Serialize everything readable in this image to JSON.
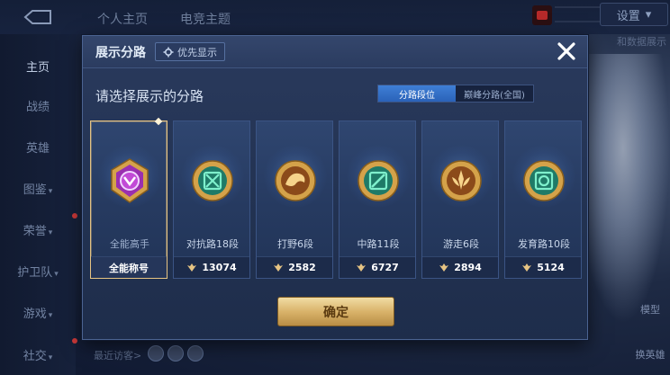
{
  "topbar": {
    "tabs": [
      "个人主页",
      "电竞主题"
    ],
    "settings_label": "设置",
    "right_hint": "和数据展示"
  },
  "sidebar": {
    "items": [
      {
        "label": "主页",
        "active": true
      },
      {
        "label": "战绩"
      },
      {
        "label": "英雄"
      },
      {
        "label": "图鉴",
        "caret": "▾"
      },
      {
        "label": "荣誉",
        "caret": "▾"
      },
      {
        "label": "护卫队",
        "caret": "▾"
      },
      {
        "label": "游戏",
        "caret": "▾"
      },
      {
        "label": "社交",
        "caret": "▾"
      }
    ]
  },
  "right_shortcuts": [
    "模型",
    "换英雄"
  ],
  "bottom": {
    "recent_visitors": "最近访客>"
  },
  "modal": {
    "title": "展示分路",
    "priority_label": "优先显示",
    "prompt": "请选择展示的分路",
    "toggle": [
      {
        "label": "分路段位",
        "selected": true
      },
      {
        "label": "巅峰分路(全国)",
        "selected": false
      }
    ],
    "cards": [
      {
        "label": "全能高手",
        "stat": "全能称号",
        "emblem": "purple-allround-emblem-icon",
        "color": "#b23ac6",
        "selected": true
      },
      {
        "label": "对抗路18段",
        "stat": "13074",
        "emblem": "clash-lane-emblem-icon",
        "color": "#2ec49a"
      },
      {
        "label": "打野6段",
        "stat": "2582",
        "emblem": "jungle-emblem-icon",
        "color": "#d99a3a"
      },
      {
        "label": "中路11段",
        "stat": "6727",
        "emblem": "mid-lane-emblem-icon",
        "color": "#2ec49a"
      },
      {
        "label": "游走6段",
        "stat": "2894",
        "emblem": "roam-emblem-icon",
        "color": "#d99a3a"
      },
      {
        "label": "发育路10段",
        "stat": "5124",
        "emblem": "farm-lane-emblem-icon",
        "color": "#2ec49a"
      }
    ],
    "confirm_label": "确定"
  },
  "colors": {
    "accent_gold": "#e6c483",
    "toggle_blue": "#3f7fd6"
  }
}
